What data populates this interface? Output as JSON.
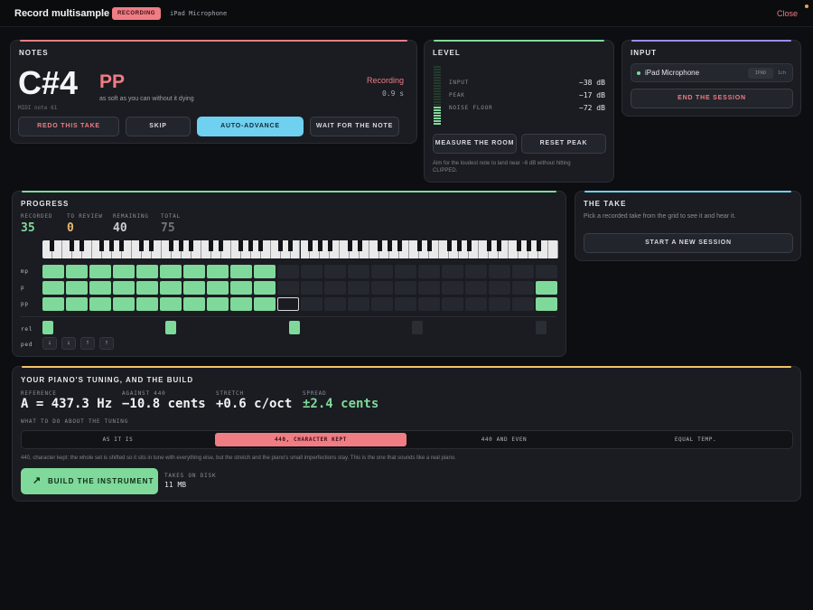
{
  "topbar": {
    "title": "Record multisample",
    "badge": "RECORDING",
    "device": "iPad Microphone",
    "close": "Close"
  },
  "notes": {
    "title": "NOTES",
    "note": "C#4",
    "dynamic": "PP",
    "hint": "as soft as you can without it dying",
    "midi": "MIDI note 61",
    "status": "Recording",
    "time": "0.9 s",
    "buttons": {
      "redo": "REDO THIS TAKE",
      "skip": "SKIP",
      "auto": "AUTO-ADVANCE",
      "wait": "WAIT FOR THE NOTE"
    }
  },
  "level": {
    "title": "LEVEL",
    "rows": [
      {
        "label": "INPUT",
        "value": "−38 dB"
      },
      {
        "label": "PEAK",
        "value": "−17 dB"
      },
      {
        "label": "NOISE FLOOR",
        "value": "−72 dB"
      }
    ],
    "measure": "MEASURE THE ROOM",
    "reset": "RESET PEAK",
    "help": "Aim for the loudest note to land near −6 dB without hitting CLIPPED.",
    "meter_fraction": 0.3
  },
  "input": {
    "title": "INPUT",
    "device": "iPad Microphone",
    "tag1": "IPAD",
    "tag2": "1ch",
    "end": "END THE SESSION"
  },
  "progress": {
    "title": "PROGRESS",
    "stats": [
      {
        "label": "RECORDED",
        "value": "35",
        "color": "#7fd99a"
      },
      {
        "label": "TO REVIEW",
        "value": "0",
        "color": "#e8b86a"
      },
      {
        "label": "REMAINING",
        "value": "40",
        "color": "#c9ccd2"
      },
      {
        "label": "TOTAL",
        "value": "75",
        "color": "#6f737b"
      }
    ],
    "rows": [
      "mp",
      "p",
      "pp"
    ],
    "rel": "rel",
    "ped": "ped",
    "ped_buttons": [
      "↓",
      "↓",
      "↑",
      "↑"
    ]
  },
  "take": {
    "title": "THE TAKE",
    "hint": "Pick a recorded take from the grid to see it and hear it.",
    "start": "START A NEW SESSION"
  },
  "tuning": {
    "title": "YOUR PIANO'S TUNING, AND THE BUILD",
    "metrics": [
      {
        "label": "REFERENCE",
        "value": "A = 437.3 Hz"
      },
      {
        "label": "AGAINST 440",
        "value": "−10.8 cents"
      },
      {
        "label": "STRETCH",
        "value": "+0.6 c/oct"
      },
      {
        "label": "SPREAD",
        "value": "±2.4 cents"
      }
    ],
    "what": "WHAT TO DO ABOUT THE TUNING",
    "options": [
      "AS IT IS",
      "440, CHARACTER KEPT",
      "440 AND EVEN",
      "EQUAL TEMP."
    ],
    "desc": "440, character kept: the whole set is shifted so it sits in tune with everything else, but the stretch and the piano's small imperfections stay. This is the one that sounds like a real piano.",
    "build": "BUILD THE INSTRUMENT",
    "disk_label": "TAKES ON DISK",
    "disk_value": "11 MB"
  },
  "colors": {
    "green": "#7fd99a",
    "red": "#f07c84",
    "blue": "#6fd0f0",
    "purple": "#9b8cf5",
    "amber": "#f3c36a"
  }
}
